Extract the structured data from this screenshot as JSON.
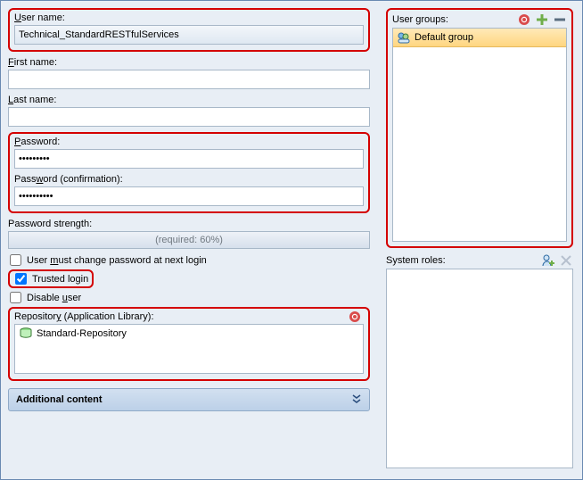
{
  "form": {
    "username_label": "User name:",
    "username_value": "Technical_StandardRESTfulServices",
    "firstname_label": "First name:",
    "firstname_value": "",
    "lastname_label": "Last name:",
    "lastname_value": "",
    "password_label": "Password:",
    "password_value": "•••••••••",
    "password_confirm_label": "Password (confirmation):",
    "password_confirm_value": "••••••••••",
    "strength_label": "Password strength:",
    "strength_placeholder": "(required: 60%)",
    "must_change_label": "User must change password at next login",
    "must_change_checked": false,
    "trusted_label": "Trusted login",
    "trusted_checked": true,
    "disable_label": "Disable user",
    "disable_checked": false,
    "repository_label": "Repository (Application Library):",
    "repository_item": "Standard-Repository",
    "additional_content_label": "Additional content"
  },
  "accel": {
    "username": "U",
    "firstname": "F",
    "lastname": "L",
    "password": "P",
    "password_confirm": "w",
    "must_change": "m",
    "disable": "u",
    "repository": "y"
  },
  "sidepanel": {
    "groups_label": "User groups:",
    "groups_items": [
      "Default group"
    ],
    "roles_label": "System roles:"
  },
  "icons": {
    "required": "required-icon",
    "add": "add-icon",
    "remove": "remove-icon",
    "role_add": "role-add-icon",
    "role_remove": "role-remove-icon"
  }
}
